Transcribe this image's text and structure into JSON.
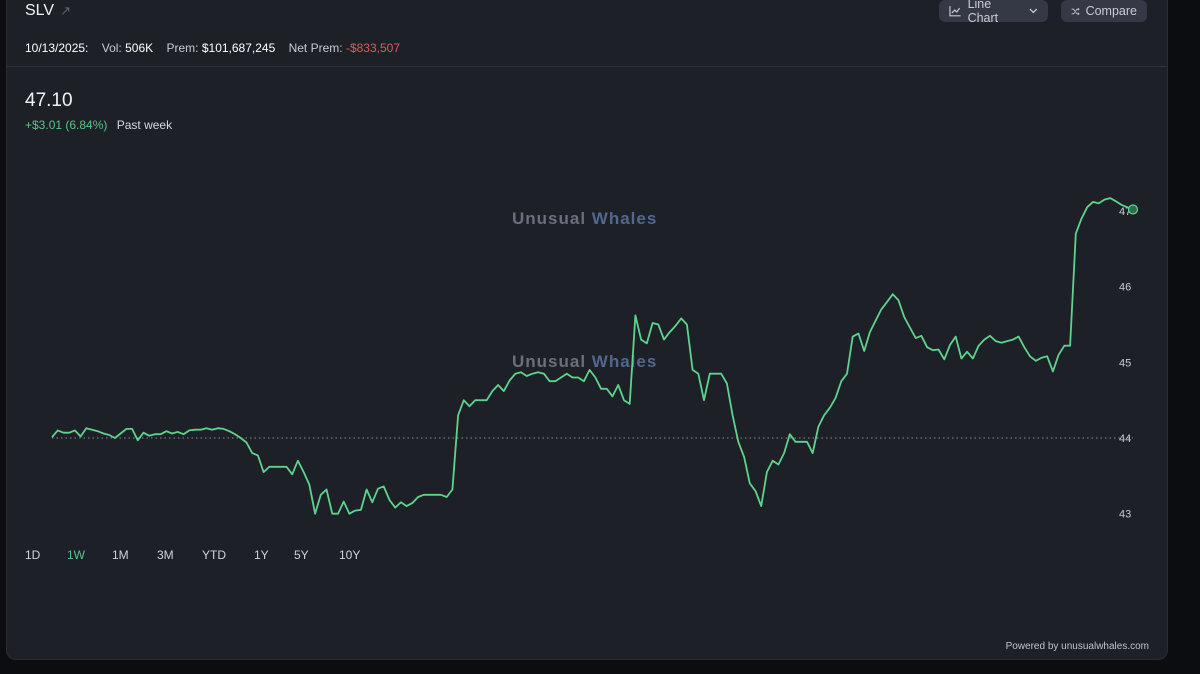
{
  "header": {
    "ticker": "SLV",
    "chart_type_label": "Line Chart",
    "compare_label": "Compare"
  },
  "stats": {
    "date": "10/13/2025:",
    "vol_label": "Vol:",
    "vol_value": "506K",
    "prem_label": "Prem:",
    "prem_value": "$101,687,245",
    "net_prem_label": "Net Prem:",
    "net_prem_value": "-$833,507"
  },
  "summary": {
    "price": "47.10",
    "change": "+$3.01 (6.84%)",
    "period": "Past week"
  },
  "watermark": {
    "part1": "Unusual",
    "part2": "Whales"
  },
  "ranges": [
    "1D",
    "1W",
    "1M",
    "3M",
    "YTD",
    "1Y",
    "5Y",
    "10Y"
  ],
  "active_range": "1W",
  "footer": {
    "powered": "Powered by unusualwhales.com"
  },
  "colors": {
    "line": "#5fd38c",
    "background": "#1e2028",
    "negative": "#e05a5a",
    "positive": "#58c487"
  },
  "chart_data": {
    "type": "line",
    "title": "",
    "xlabel": "",
    "ylabel": "",
    "ylim": [
      42.8,
      47.3
    ],
    "yticks": [
      43,
      44,
      45,
      46,
      47
    ],
    "reference_line": 44.0,
    "grid": false,
    "series": [
      {
        "values": [
          44.01,
          44.1,
          44.07,
          44.07,
          44.1,
          44.02,
          44.13,
          44.11,
          44.09,
          44.06,
          44.04,
          44.0,
          44.06,
          44.12,
          44.12,
          43.97,
          44.07,
          44.03,
          44.05,
          44.05,
          44.09,
          44.06,
          44.08,
          44.05,
          44.1,
          44.11,
          44.11,
          44.13,
          44.11,
          44.13,
          44.12,
          44.09,
          44.05,
          44.0,
          43.94,
          43.8,
          43.77,
          43.55,
          43.62,
          43.62,
          43.62,
          43.62,
          43.52,
          43.7,
          43.55,
          43.38,
          43.0,
          43.25,
          43.32,
          43.0,
          43.0,
          43.16,
          43.0,
          43.04,
          43.05,
          43.32,
          43.15,
          43.33,
          43.36,
          43.18,
          43.08,
          43.15,
          43.1,
          43.14,
          43.22,
          43.25,
          43.25,
          43.25,
          43.25,
          43.22,
          43.32,
          44.3,
          44.5,
          44.42,
          44.5,
          44.5,
          44.5,
          44.62,
          44.7,
          44.62,
          44.76,
          44.85,
          44.87,
          44.82,
          44.85,
          44.87,
          44.85,
          44.75,
          44.75,
          44.8,
          44.85,
          44.8,
          44.8,
          44.75,
          44.9,
          44.8,
          44.65,
          44.65,
          44.55,
          44.7,
          44.5,
          44.45,
          45.62,
          45.3,
          45.25,
          45.52,
          45.5,
          45.3,
          45.4,
          45.48,
          45.58,
          45.5,
          44.9,
          44.85,
          44.5,
          44.85,
          44.85,
          44.85,
          44.72,
          44.3,
          43.95,
          43.75,
          43.4,
          43.3,
          43.1,
          43.55,
          43.7,
          43.65,
          43.8,
          44.05,
          43.95,
          43.95,
          43.95,
          43.8,
          44.15,
          44.3,
          44.4,
          44.53,
          44.75,
          44.85,
          45.34,
          45.38,
          45.15,
          45.4,
          45.55,
          45.7,
          45.8,
          45.9,
          45.82,
          45.6,
          45.46,
          45.32,
          45.35,
          45.2,
          45.16,
          45.17,
          45.04,
          45.23,
          45.34,
          45.05,
          45.14,
          45.05,
          45.22,
          45.3,
          45.35,
          45.28,
          45.26,
          45.28,
          45.3,
          45.34,
          45.2,
          45.08,
          45.02,
          45.06,
          45.08,
          44.88,
          45.1,
          45.22,
          45.22,
          46.7,
          46.9,
          47.05,
          47.12,
          47.1,
          47.15,
          47.17,
          47.13,
          47.08,
          47.05,
          47.02
        ]
      }
    ]
  }
}
